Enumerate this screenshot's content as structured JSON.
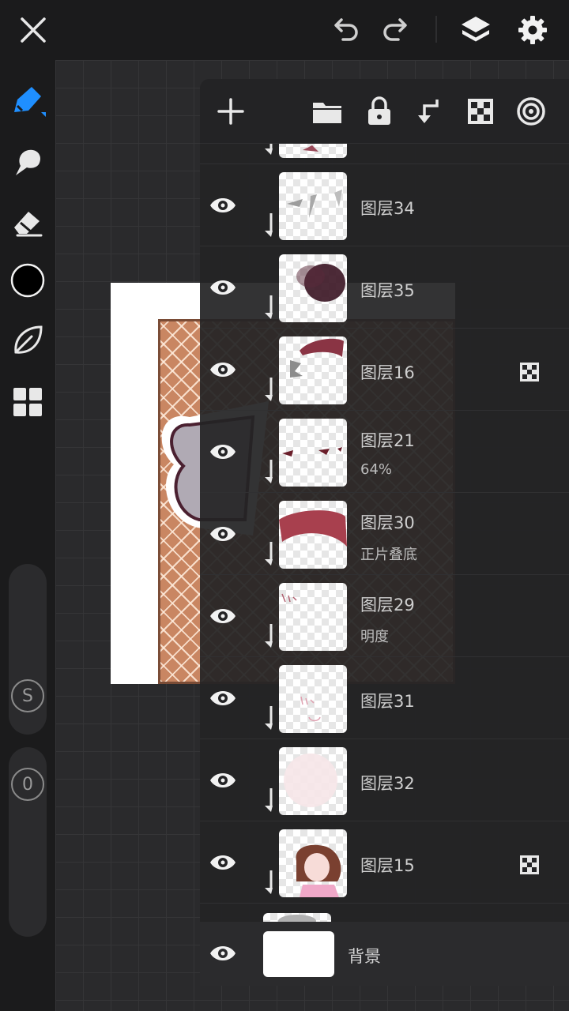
{
  "layers": [
    {
      "name": "图层34",
      "mode": "",
      "alpha_locked": false
    },
    {
      "name": "图层35",
      "mode": "",
      "alpha_locked": false
    },
    {
      "name": "图层16",
      "mode": "",
      "alpha_locked": true
    },
    {
      "name": "图层21",
      "mode": "64%",
      "alpha_locked": false
    },
    {
      "name": "图层30",
      "mode": "正片叠底",
      "alpha_locked": false
    },
    {
      "name": "图层29",
      "mode": "明度",
      "alpha_locked": false
    },
    {
      "name": "图层31",
      "mode": "",
      "alpha_locked": false
    },
    {
      "name": "图层32",
      "mode": "",
      "alpha_locked": false
    },
    {
      "name": "图层15",
      "mode": "",
      "alpha_locked": true
    }
  ],
  "background_layer": {
    "name": "背景"
  },
  "brush_size_label": "S",
  "opacity_label": "0",
  "colors": {
    "accent": "#1f8fff",
    "current_color": "#000000",
    "panel": "#232325",
    "icon": "#e8e8e8"
  }
}
